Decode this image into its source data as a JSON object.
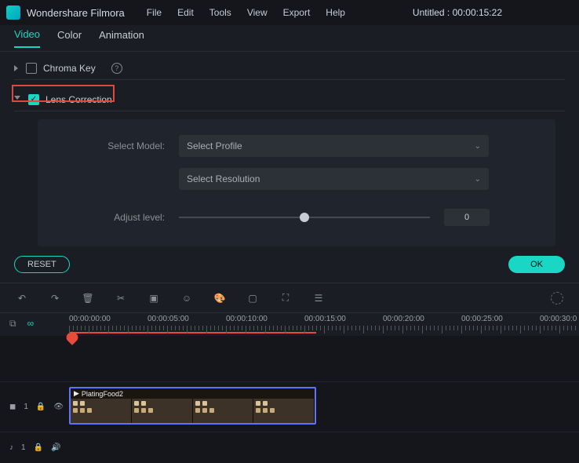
{
  "app": {
    "name": "Wondershare Filmora"
  },
  "menu": {
    "file": "File",
    "edit": "Edit",
    "tools": "Tools",
    "view": "View",
    "export": "Export",
    "help": "Help"
  },
  "document": {
    "title": "Untitled : 00:00:15:22"
  },
  "subtabs": {
    "video": "Video",
    "color": "Color",
    "animation": "Animation",
    "active": "video"
  },
  "sections": {
    "chroma": {
      "label": "Chroma Key",
      "checked": false,
      "open": false
    },
    "lens": {
      "label": "Lens Correction",
      "checked": true,
      "open": true
    }
  },
  "lens_form": {
    "select_model_label": "Select Model:",
    "select_model_value": "Select Profile",
    "select_res_value": "Select Resolution",
    "adjust_label": "Adjust level:",
    "adjust_value": "0"
  },
  "buttons": {
    "reset": "RESET",
    "ok": "OK"
  },
  "timeline": {
    "ticks": [
      "00:00:00:00",
      "00:00:05:00",
      "00:00:10:00",
      "00:00:15:00",
      "00:00:20:00",
      "00:00:25:00",
      "00:00:30:0"
    ],
    "playhead_at": 3,
    "clip_name": "PlatingFood2"
  },
  "tracks": {
    "video": {
      "index": "1"
    },
    "audio": {
      "index": "1"
    }
  }
}
